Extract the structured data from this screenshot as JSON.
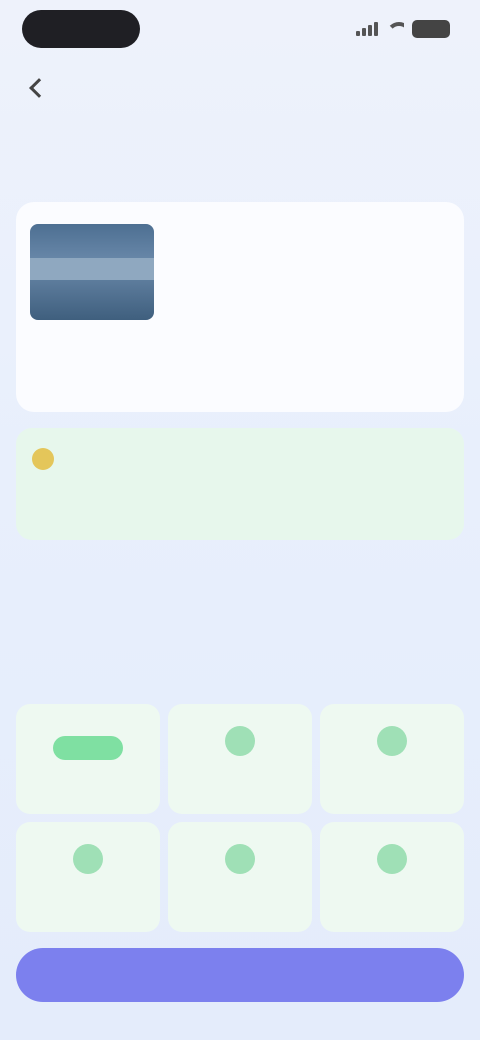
{
  "status": {
    "time": "",
    "battery": ""
  },
  "header": {
    "title": ""
  },
  "hero": {
    "small_title": "",
    "title": ""
  },
  "product": {
    "title": "",
    "tag": "",
    "price": ""
  },
  "promo": {
    "prefix": "",
    "highlight": "",
    "suffix": "",
    "body": ""
  },
  "perks_section": {
    "title": "",
    "subtitle": ""
  },
  "perks": [
    {
      "label": "",
      "icon": "badge-icon"
    },
    {
      "label": "",
      "icon": "perk-icon"
    },
    {
      "label": "",
      "icon": "perk-icon"
    },
    {
      "label": "",
      "icon": "perk-icon"
    },
    {
      "label": "",
      "icon": "perk-icon"
    },
    {
      "label": "",
      "icon": "perk-icon"
    }
  ],
  "cta": {
    "label": ""
  },
  "colors": {
    "accent": "#7c80ee",
    "promo_green": "#28c16a",
    "card_bg": "#fbfcff"
  }
}
